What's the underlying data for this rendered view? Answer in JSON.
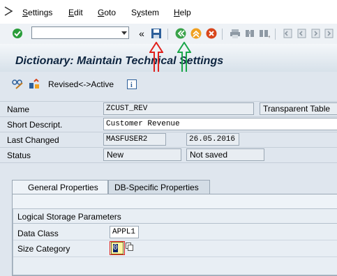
{
  "menu": {
    "items": [
      {
        "label": "Settings",
        "underline": "S",
        "rest": "ettings"
      },
      {
        "label": "Edit",
        "underline": "E",
        "rest": "dit"
      },
      {
        "label": "Goto",
        "underline": "G",
        "rest": "oto"
      },
      {
        "label": "System",
        "underline": "y",
        "pre": "S",
        "rest": "stem"
      },
      {
        "label": "Help",
        "underline": "H",
        "rest": "elp"
      }
    ]
  },
  "toolbar": {
    "command_value": "",
    "icons": [
      "enter-icon",
      "save-icon",
      "back-icon",
      "exit-icon",
      "cancel-icon",
      "print-icon",
      "find-icon",
      "find-next-icon",
      "first-page-icon",
      "prev-page-icon",
      "next-page-icon",
      "last-page-icon"
    ]
  },
  "title": "Dictionary: Maintain Technical Settings",
  "app_toolbar": {
    "revised_label": "Revised<->Active"
  },
  "fields": {
    "name_label": "Name",
    "name_value": "ZCUST_REV",
    "table_type": "Transparent Table",
    "short_desc_label": "Short Descript.",
    "short_desc_value": "Customer Revenue",
    "last_changed_label": "Last Changed",
    "last_changed_user": "MASFUSER2",
    "last_changed_date": "26.05.2016",
    "status_label": "Status",
    "status_value": "New",
    "status_save": "Not saved"
  },
  "tabs": [
    {
      "label": "General Properties",
      "active": true
    },
    {
      "label": "DB-Specific Properties",
      "active": false
    }
  ],
  "group": {
    "title": "Logical Storage Parameters",
    "data_class_label": "Data Class",
    "data_class_value": "APPL1",
    "size_category_label": "Size Category",
    "size_category_value": "0"
  },
  "colors": {
    "annotation_red": "#e0201c",
    "annotation_green": "#1aa64a",
    "title_text": "#0e2540"
  }
}
